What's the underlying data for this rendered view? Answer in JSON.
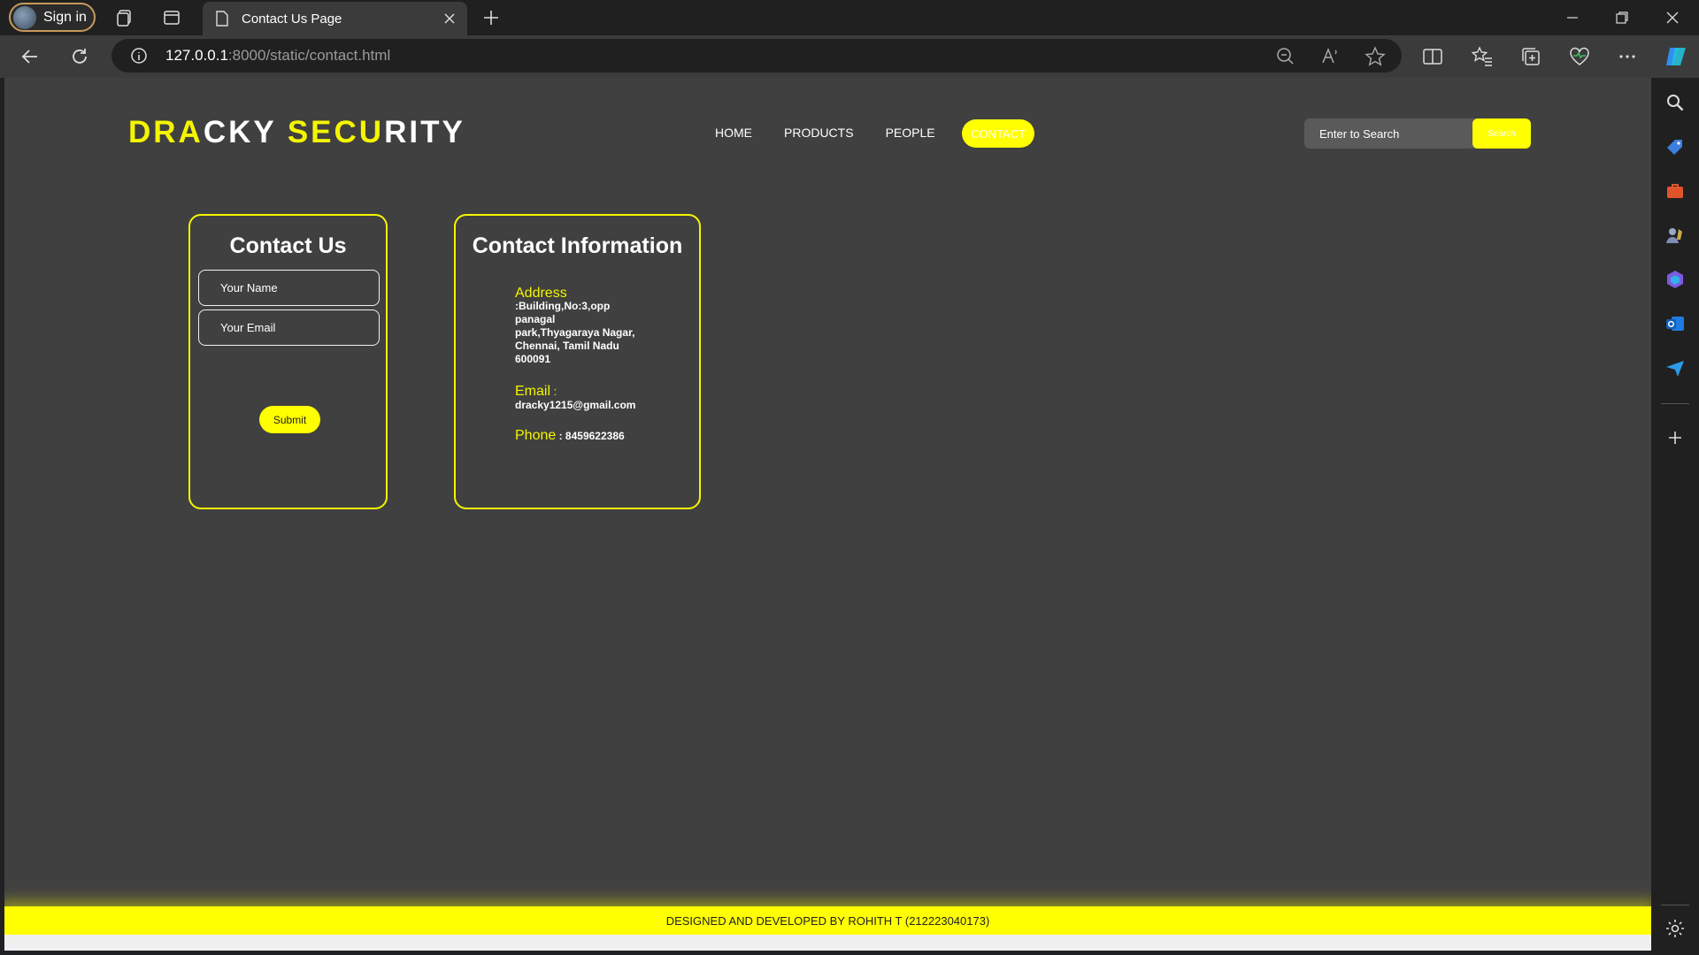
{
  "browser": {
    "signin_label": "Sign in",
    "tab_title": "Contact Us Page",
    "url_host": "127.0.0.1",
    "url_path": ":8000/static/contact.html"
  },
  "site": {
    "logo_parts": [
      "DRA",
      "CKY ",
      "SECU",
      "RITY"
    ],
    "nav": [
      "HOME",
      "PRODUCTS",
      "PEOPLE",
      "CONTACT"
    ],
    "search_placeholder": "Enter to Search",
    "search_button": "Search"
  },
  "form": {
    "title": "Contact Us",
    "name_placeholder": "Your Name",
    "email_placeholder": "Your Email",
    "submit_label": "Submit"
  },
  "info": {
    "title": "Contact Information",
    "address_label": "Address",
    "address_lines": [
      ":Building,No:3,opp",
      "panagal",
      "park,Thyagaraya Nagar,",
      "Chennai, Tamil Nadu",
      "600091"
    ],
    "email_label": "Email",
    "email_sep": " :",
    "email_value": "dracky1215@gmail.com",
    "phone_label": "Phone",
    "phone_value": " : 8459622386"
  },
  "footer": "DESIGNED AND DEVELOPED BY ROHITH T (212223040173)",
  "colors": {
    "accent": "#ffff00",
    "page_bg": "#404040"
  }
}
